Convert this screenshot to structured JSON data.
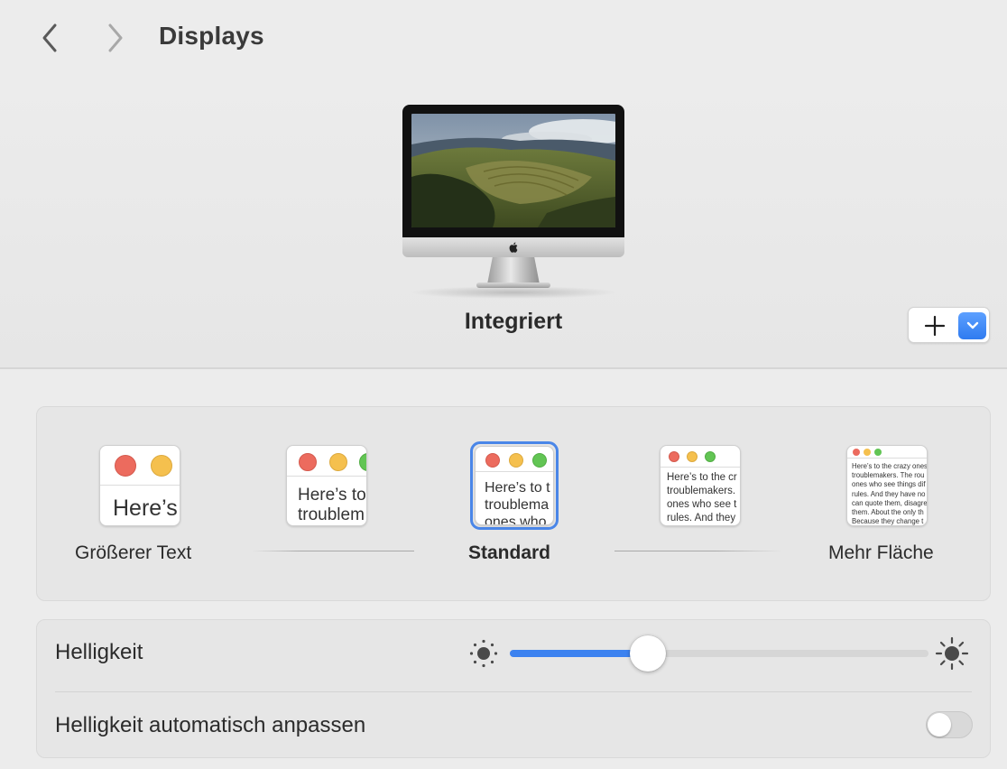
{
  "header": {
    "title": "Displays",
    "back_icon": "chevron-left-icon",
    "forward_icon": "chevron-right-icon"
  },
  "display": {
    "name": "Integriert",
    "add_icon": "plus-icon",
    "dropdown_icon": "chevron-down-icon",
    "accent": "#2f7bf0"
  },
  "resolution": {
    "selected": "Standard",
    "labels": {
      "larger": "Größerer Text",
      "standard": "Standard",
      "more": "Mehr Fläche"
    },
    "previews": {
      "larger": "Here’s",
      "option2": "Here’s to\ntroublem",
      "standard": "Here’s to t\ntroublema\nones who",
      "option4": "Here’s to the cr\ntroublemakers.\nones who see t\nrules. And they",
      "more": "Here’s to the crazy ones\ntroublemakers. The rou\nones who see things dif\nrules. And they have no\ncan quote them, disagre\nthem. About the only th\nBecause they change t"
    }
  },
  "brightness": {
    "label": "Helligkeit",
    "value": 0.33,
    "auto_label": "Helligkeit automatisch anpassen",
    "auto_enabled": false,
    "sun_small_icon": "sun-dim-icon",
    "sun_large_icon": "sun-bright-icon"
  }
}
